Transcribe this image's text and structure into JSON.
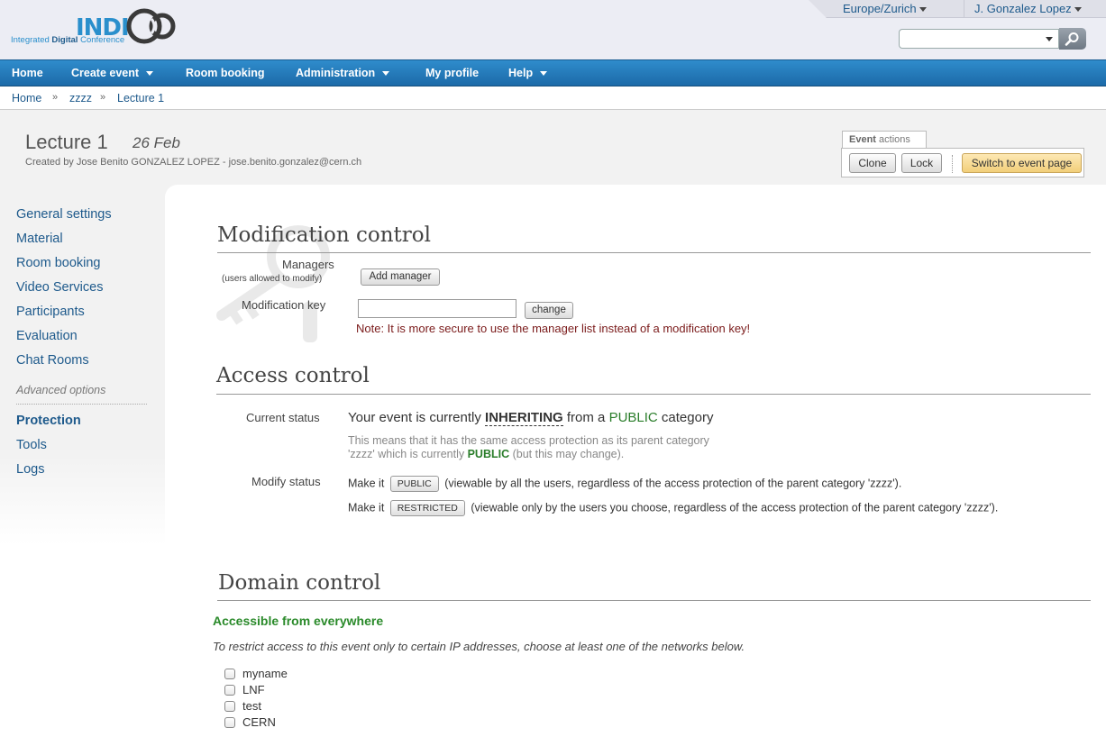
{
  "header": {
    "logo_main": "INDI",
    "logo_sub_prefix": "Integrated ",
    "logo_sub_bold": "Digital",
    "logo_sub_suffix": " Conference",
    "timezone": "Europe/Zurich",
    "user": "J. Gonzalez Lopez",
    "search_value": ""
  },
  "nav": {
    "items": [
      {
        "label": "Home"
      },
      {
        "label": "Create event"
      },
      {
        "label": "Room booking"
      },
      {
        "label": "Administration"
      },
      {
        "label": "My profile"
      },
      {
        "label": "Help"
      }
    ]
  },
  "breadcrumb": {
    "items": [
      "Home",
      "zzzz",
      "Lecture 1"
    ],
    "separator": "»"
  },
  "event": {
    "title": "Lecture 1",
    "date": "26 Feb",
    "creator": "Created by Jose Benito GONZALEZ LOPEZ - jose.benito.gonzalez@cern.ch",
    "actions_tab_bold": "Event",
    "actions_tab_rest": " actions",
    "clone_label": "Clone",
    "lock_label": "Lock",
    "switch_label": "Switch to event page"
  },
  "sidebar": {
    "items": [
      {
        "label": "General settings"
      },
      {
        "label": "Material"
      },
      {
        "label": "Room booking"
      },
      {
        "label": "Video Services"
      },
      {
        "label": "Participants"
      },
      {
        "label": "Evaluation"
      },
      {
        "label": "Chat Rooms"
      }
    ],
    "advanced_label": "Advanced options",
    "advanced_items": [
      {
        "label": "Protection",
        "active": true
      },
      {
        "label": "Tools"
      },
      {
        "label": "Logs"
      }
    ]
  },
  "modification": {
    "title": "Modification control",
    "managers_label": "Managers",
    "managers_sub": "(users allowed to modify)",
    "add_manager_label": "Add manager",
    "key_label": "Modification key",
    "key_value": "",
    "change_label": "change",
    "note": "Note: It is more secure to use the manager list instead of a modification key!"
  },
  "access": {
    "title": "Access control",
    "current_status_label": "Current status",
    "status_prefix": "Your event is currently ",
    "status_strong": "INHERITING",
    "status_mid": " from a ",
    "status_public": "PUBLIC",
    "status_suffix": " category",
    "explain_line1": "This means that it has the same access protection as its parent category",
    "explain_line2_prefix": "'zzzz' which is currently ",
    "explain_line2_public": "PUBLIC",
    "explain_line2_suffix": " (but this may change).",
    "modify_status_label": "Modify status",
    "make_it": "Make it",
    "public_button": "PUBLIC",
    "public_text": "(viewable by all the users, regardless of the access protection of the parent category 'zzzz').",
    "restricted_button": "RESTRICTED",
    "restricted_text": "(viewable only by the users you choose, regardless of the access protection of the parent category 'zzzz')."
  },
  "domain": {
    "title": "Domain control",
    "status": "Accessible from everywhere",
    "help": "To restrict access to this event only to certain IP addresses, choose at least one of the networks below.",
    "networks": [
      {
        "label": "myname",
        "checked": false
      },
      {
        "label": "LNF",
        "checked": false
      },
      {
        "label": "test",
        "checked": false
      },
      {
        "label": "CERN",
        "checked": false
      }
    ]
  },
  "colors": {
    "nav_blue": "#2f8ccc",
    "link_blue": "#1e5a8c",
    "public_green": "#2a7d2a",
    "note_red": "#7a1a1a"
  }
}
